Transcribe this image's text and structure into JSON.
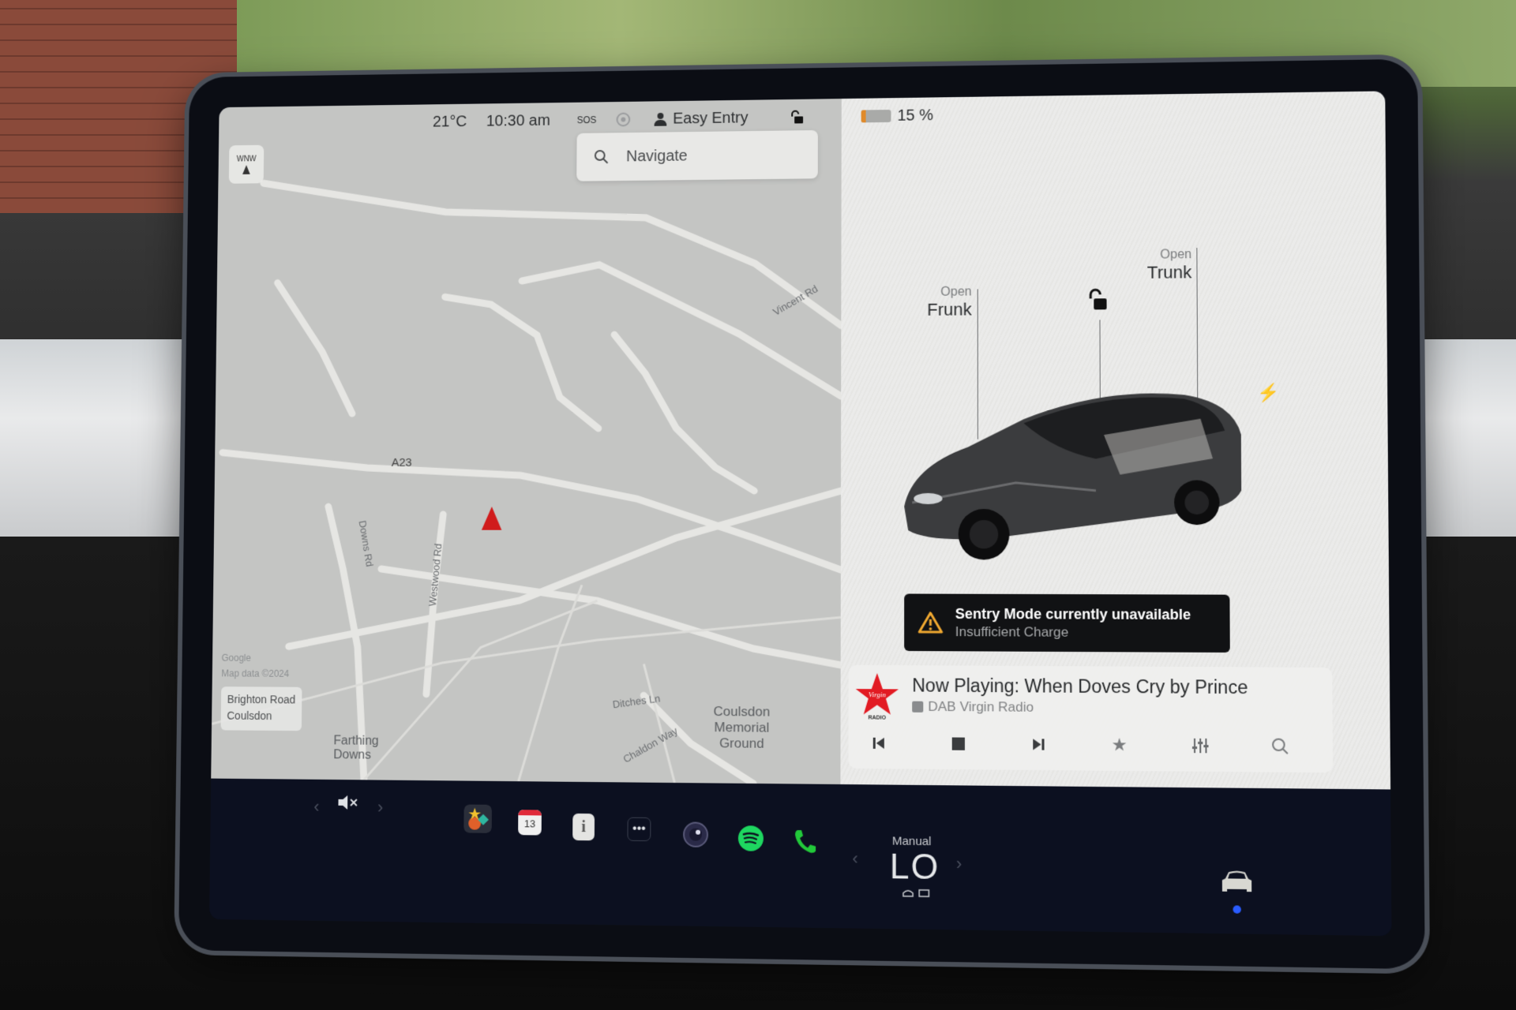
{
  "status_bar": {
    "temperature": "21°C",
    "time": "10:30 am",
    "sos_label": "SOS",
    "profile_name": "Easy Entry",
    "battery_percent": "15 %",
    "battery_level": 0.15,
    "battery_color": "#e08a2a"
  },
  "map": {
    "compass_heading": "WNW",
    "search_placeholder": "Navigate",
    "attribution_brand": "Google",
    "attribution_text": "Map data ©2024",
    "current_location": {
      "line1": "Brighton Road",
      "line2": "Coulsdon"
    },
    "labels": {
      "a23": "A23",
      "downs_rd": "Downs Rd",
      "westwood_rd": "Westwood Rd",
      "vincent_rd": "Vincent Rd",
      "ditches_ln": "Ditches Ln",
      "chaldon_way": "Chaldon Way",
      "farthing_downs": "Farthing Downs",
      "coulsdon_memorial_ground": "Coulsdon Memorial Ground"
    },
    "nav_arrow_color": "#d01c1c"
  },
  "car": {
    "frunk": {
      "action": "Open",
      "label": "Frunk"
    },
    "trunk": {
      "action": "Open",
      "label": "Trunk"
    },
    "lock_state": "unlocked",
    "charge_port_icon": "lightning-icon"
  },
  "alert": {
    "title": "Sentry Mode currently unavailable",
    "subtitle": "Insufficient Charge",
    "icon_color": "#f0a830"
  },
  "media": {
    "station_logo": "Virgin Radio UK",
    "logo_color": "#e21b23",
    "now_playing": "Now Playing: When Doves Cry by Prince",
    "source": "DAB Virgin Radio",
    "controls": [
      "previous",
      "stop",
      "next",
      "favorite",
      "equalizer",
      "search"
    ]
  },
  "dock": {
    "volume_state": "muted",
    "apps": [
      {
        "name": "toybox",
        "icon": "toybox-icon"
      },
      {
        "name": "calendar",
        "icon": "calendar-icon",
        "day": "13"
      },
      {
        "name": "manual",
        "icon": "manual-icon"
      },
      {
        "name": "more",
        "icon": "more-icon"
      },
      {
        "name": "camera",
        "icon": "camera-icon"
      },
      {
        "name": "spotify",
        "icon": "spotify-icon"
      },
      {
        "name": "phone",
        "icon": "phone-icon"
      }
    ],
    "climate": {
      "mode": "Manual",
      "temperature": "LO"
    },
    "spotify_color": "#1ed760",
    "phone_color": "#22c93a"
  }
}
